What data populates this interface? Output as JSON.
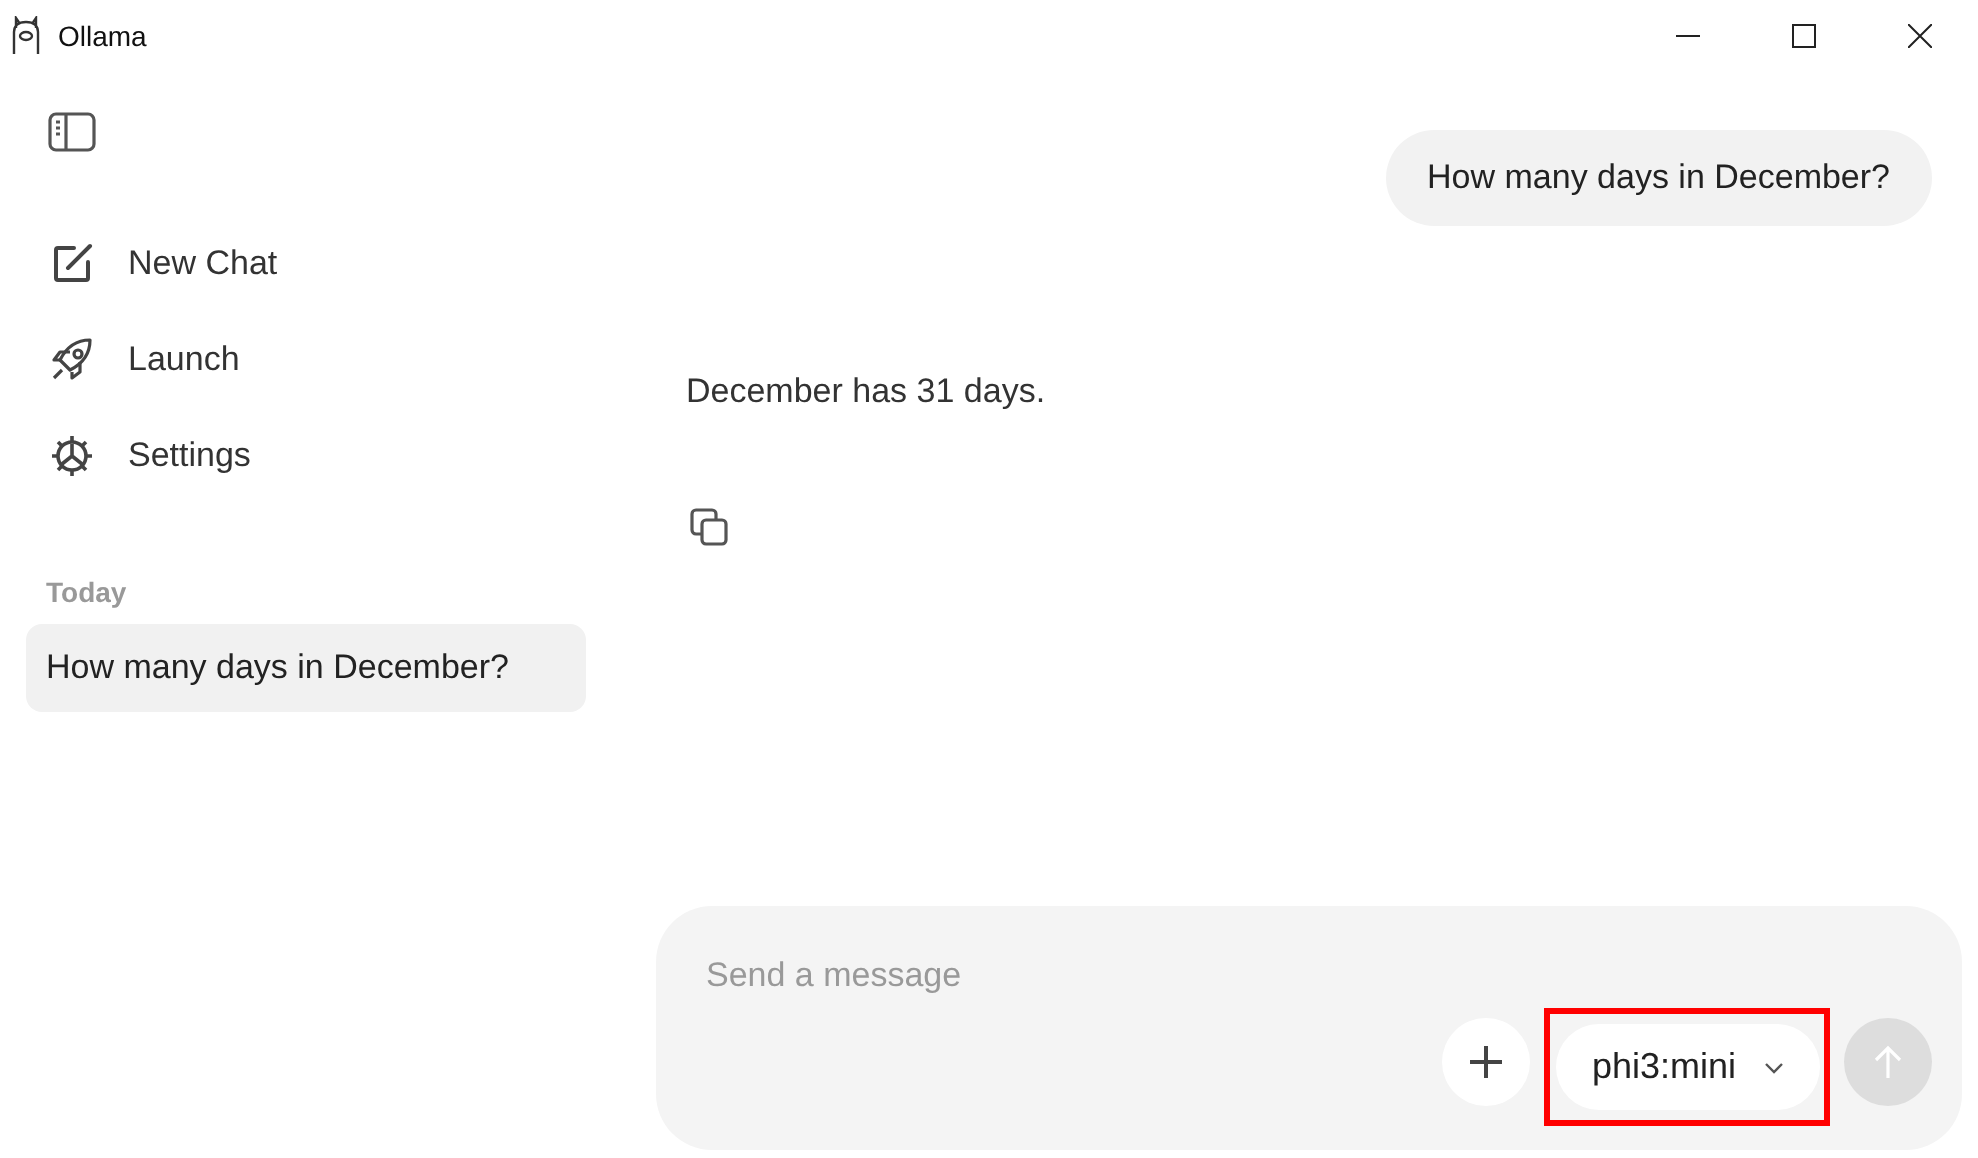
{
  "window": {
    "title": "Ollama"
  },
  "sidebar": {
    "nav": [
      {
        "label": "New Chat",
        "kind": "new-chat"
      },
      {
        "label": "Launch",
        "kind": "launch"
      },
      {
        "label": "Settings",
        "kind": "settings"
      }
    ],
    "history_heading": "Today",
    "history": [
      {
        "title": "How many days in December?",
        "selected": true
      }
    ]
  },
  "chat": {
    "messages": [
      {
        "kind": "user",
        "text": "How many days in December?"
      },
      {
        "kind": "assistant",
        "text": "December has 31 days."
      }
    ]
  },
  "composer": {
    "placeholder": "Send a message",
    "model": "phi3:mini",
    "model_highlighted": true,
    "send_disabled": true
  }
}
